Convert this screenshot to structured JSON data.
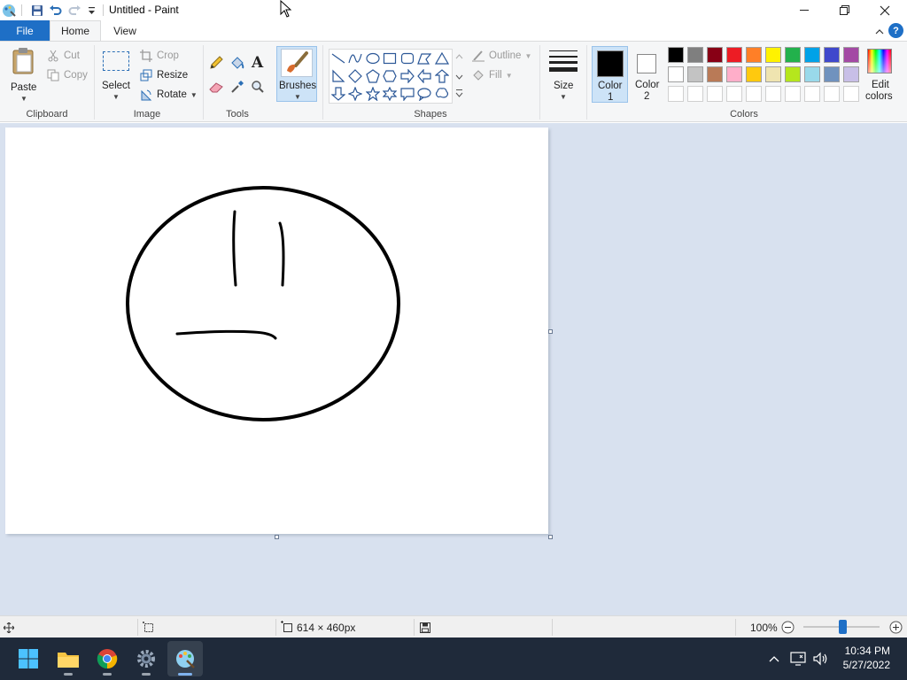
{
  "window": {
    "title": "Untitled - Paint"
  },
  "tabs": {
    "file": "File",
    "home": "Home",
    "view": "View",
    "help": "?"
  },
  "ribbon": {
    "clipboard": {
      "label": "Clipboard",
      "paste": "Paste",
      "cut": "Cut",
      "copy": "Copy"
    },
    "image": {
      "label": "Image",
      "select": "Select",
      "crop": "Crop",
      "resize": "Resize",
      "rotate": "Rotate"
    },
    "tools": {
      "label": "Tools"
    },
    "brushes": {
      "label": "Brushes"
    },
    "shapes": {
      "label": "Shapes",
      "outline": "Outline",
      "fill": "Fill"
    },
    "size": {
      "label": "Size"
    },
    "colors": {
      "label": "Colors",
      "color1_line1": "Color",
      "color1_line2": "1",
      "color2_line1": "Color",
      "color2_line2": "2",
      "edit_line1": "Edit",
      "edit_line2": "colors",
      "color1": "#000000",
      "color2": "#ffffff",
      "palette_row1": [
        "#000000",
        "#7f7f7f",
        "#880015",
        "#ed1c24",
        "#ff7f27",
        "#fff200",
        "#22b14c",
        "#00a2e8",
        "#3f48cc",
        "#a349a4"
      ],
      "palette_row2": [
        "#ffffff",
        "#c3c3c3",
        "#b97a57",
        "#ffaec9",
        "#ffc90e",
        "#efe4b0",
        "#b5e61d",
        "#99d9ea",
        "#7092be",
        "#c8bfe7"
      ]
    }
  },
  "statusbar": {
    "dimensions": "614 × 460px",
    "zoom": "100%",
    "zoom_fraction": 0.5
  },
  "taskbar": {
    "time": "10:34 PM",
    "date": "5/27/2022"
  }
}
